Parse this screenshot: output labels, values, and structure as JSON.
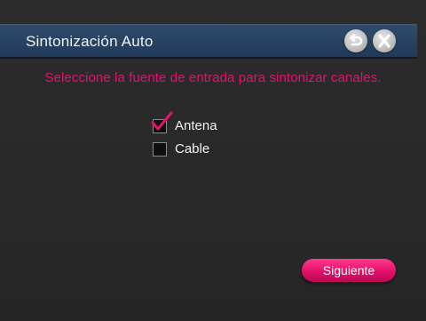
{
  "window": {
    "title": "Sintonización Auto",
    "back_icon": "back-arrow-icon",
    "close_icon": "close-x-icon"
  },
  "prompt": "Seleccione la fuente de entrada para sintonizar canales.",
  "options": [
    {
      "label": "Antena",
      "checked": true
    },
    {
      "label": "Cable",
      "checked": false
    }
  ],
  "next_button": {
    "label": "Siguiente"
  },
  "colors": {
    "accent": "#e5106d",
    "titlebar": "#27425f",
    "background": "#2a2a2a"
  }
}
